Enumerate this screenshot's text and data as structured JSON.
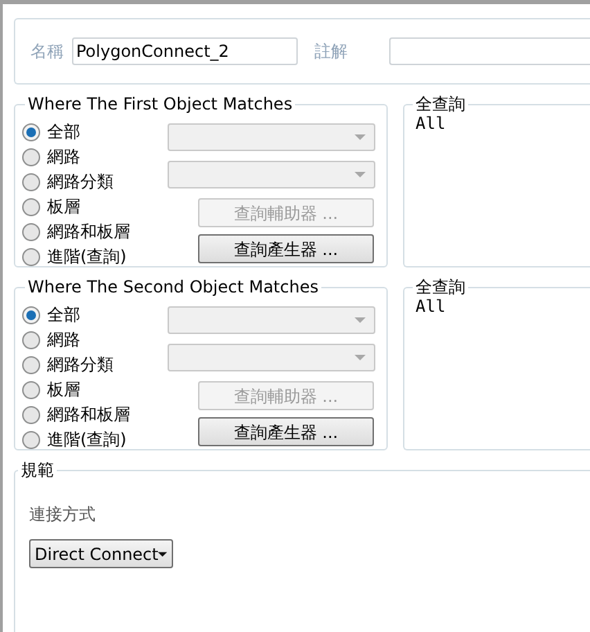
{
  "header": {
    "name_label": "名稱",
    "name_value": "PolygonConnect_2",
    "comment_label": "註解"
  },
  "groups": [
    {
      "title": "Where The First Object Matches",
      "options": [
        {
          "label": "全部",
          "selected": true
        },
        {
          "label": "網路",
          "selected": false
        },
        {
          "label": "網路分類",
          "selected": false
        },
        {
          "label": "板層",
          "selected": false
        },
        {
          "label": "網路和板層",
          "selected": false
        },
        {
          "label": "進階(查詢)",
          "selected": false
        }
      ],
      "dropdowns": [
        {
          "disabled": true
        },
        {
          "disabled": true
        }
      ],
      "buttons": [
        {
          "label": "查詢輔助器 ...",
          "disabled": true
        },
        {
          "label": "查詢產生器 ...",
          "disabled": false
        }
      ],
      "query": {
        "title": "全查詢",
        "text": "All"
      }
    },
    {
      "title": "Where The Second Object Matches",
      "options": [
        {
          "label": "全部",
          "selected": true
        },
        {
          "label": "網路",
          "selected": false
        },
        {
          "label": "網路分類",
          "selected": false
        },
        {
          "label": "板層",
          "selected": false
        },
        {
          "label": "網路和板層",
          "selected": false
        },
        {
          "label": "進階(查詢)",
          "selected": false
        }
      ],
      "dropdowns": [
        {
          "disabled": true
        },
        {
          "disabled": true
        }
      ],
      "buttons": [
        {
          "label": "查詢輔助器 ...",
          "disabled": true
        },
        {
          "label": "查詢產生器 ...",
          "disabled": false
        }
      ],
      "query": {
        "title": "全查詢",
        "text": "All"
      }
    }
  ],
  "rule": {
    "title": "規範",
    "connect_label": "連接方式",
    "connect_value": "Direct Connect"
  }
}
